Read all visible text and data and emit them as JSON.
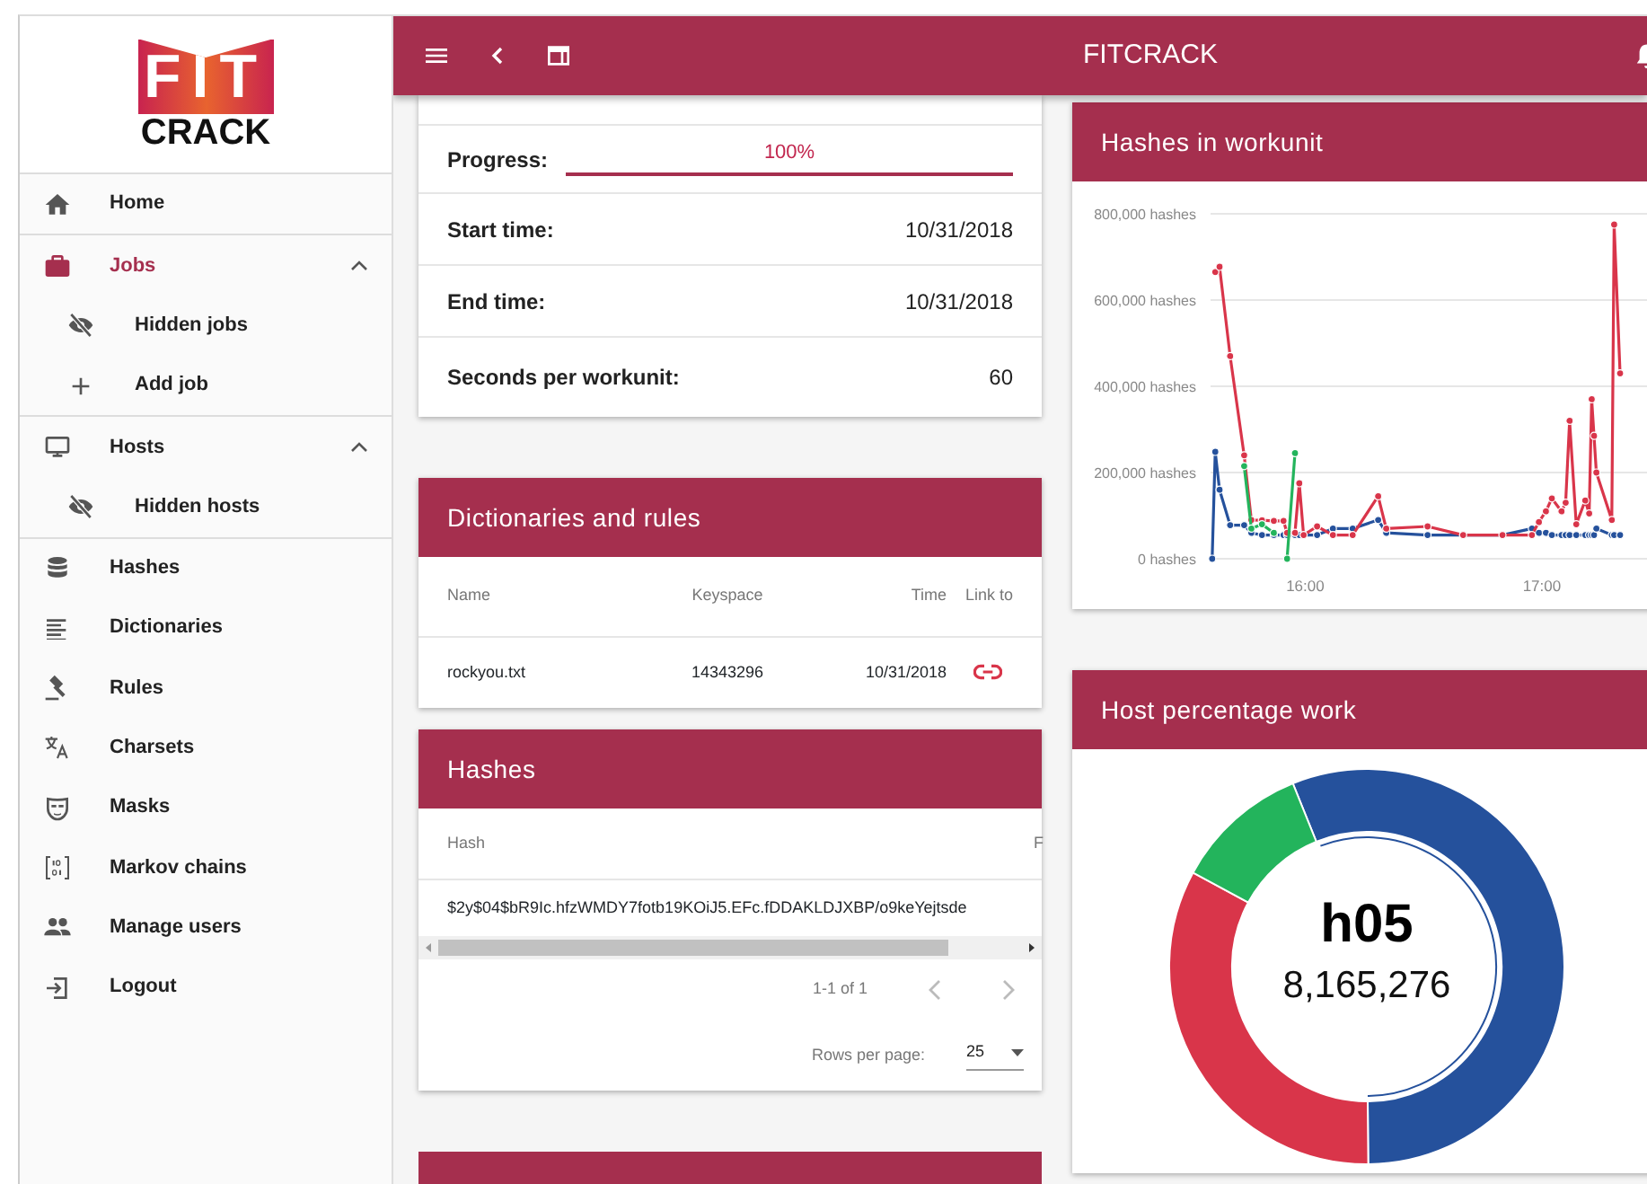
{
  "logo": {
    "top": "FIT",
    "bottom": "CRACK"
  },
  "sidebar": {
    "items": [
      {
        "label": "Home",
        "selected": false
      },
      {
        "label": "Jobs",
        "selected": true,
        "expanded": true,
        "children": [
          {
            "label": "Hidden jobs",
            "selected": false
          },
          {
            "label": "Add job",
            "selected": false
          }
        ]
      },
      {
        "label": "Hosts",
        "selected": false,
        "expanded": true,
        "children": [
          {
            "label": "Hidden hosts",
            "selected": false
          }
        ]
      },
      {
        "label": "Hashes",
        "selected": false
      },
      {
        "label": "Dictionaries",
        "selected": false
      },
      {
        "label": "Rules",
        "selected": false
      },
      {
        "label": "Charsets",
        "selected": false
      },
      {
        "label": "Masks",
        "selected": false
      },
      {
        "label": "Markov chains",
        "selected": false
      },
      {
        "label": "Manage users",
        "selected": false
      },
      {
        "label": "Logout",
        "selected": false
      }
    ]
  },
  "topbar": {
    "title": "FITCRACK"
  },
  "job_info": {
    "progress": {
      "label": "Progress:",
      "reading": "100%",
      "level": 1
    },
    "rows": [
      {
        "label": "Start time:",
        "value": "10/31/2018"
      },
      {
        "label": "End time:",
        "value": "10/31/2018"
      },
      {
        "label": "Seconds per workunit:",
        "value": "60"
      }
    ]
  },
  "dictionaries": {
    "title": "Dictionaries and rules",
    "columns": [
      "Name",
      "Keyspace",
      "Time",
      "Link to"
    ],
    "rows": [
      {
        "name": "rockyou.txt",
        "keyspace": "14343296",
        "time": "10/31/2018"
      }
    ]
  },
  "hashes": {
    "title": "Hashes",
    "columns": [
      "Hash",
      "F"
    ],
    "rows": [
      {
        "hash": "$2y$04$bR9Ic.hfzWMDY7fotb19KOiJ5.EFc.fDDAKLDJXBP/o9keYejtsde"
      }
    ],
    "range": "1-1 of 1",
    "rows_per_page_label": "Rows per page:",
    "rows_per_page": "25"
  },
  "next_card": {
    "kind": "header"
  },
  "workunit_chart": {
    "title": "Hashes in workunit",
    "chart_data": {
      "type": "line",
      "x": [
        15.607,
        15.62,
        15.638,
        15.683,
        15.742,
        15.772,
        15.817,
        15.867,
        15.908,
        15.923,
        15.957,
        15.975,
        15.993,
        16.05,
        16.117,
        16.2,
        16.308,
        16.342,
        16.517,
        16.667,
        16.833,
        16.958,
        16.987,
        17.017,
        17.042,
        17.083,
        17.1,
        17.117,
        17.145,
        17.183,
        17.2,
        17.21,
        17.22,
        17.23,
        17.295,
        17.305,
        17.33
      ],
      "series": [
        {
          "color": "#25519c",
          "values": [
            0,
            248000,
            160000,
            78000,
            78000,
            60000,
            55000,
            55000,
            55000,
            55000,
            55000,
            55000,
            55000,
            55000,
            70000,
            70000,
            90000,
            60000,
            55000,
            55000,
            55000,
            70000,
            60000,
            60000,
            55000,
            55000,
            55000,
            55000,
            55000,
            55000,
            55000,
            55000,
            55000,
            70000,
            55000,
            55000,
            55000
          ]
        },
        {
          "color": "#d9354a",
          "values": [
            null,
            665000,
            677000,
            470000,
            240000,
            90000,
            89000,
            88000,
            88000,
            60000,
            60000,
            175000,
            55000,
            75000,
            55000,
            55000,
            145000,
            70000,
            75000,
            55000,
            55000,
            55000,
            85000,
            110000,
            140000,
            110000,
            130000,
            320000,
            80000,
            135000,
            105000,
            370000,
            285000,
            200000,
            90000,
            775000,
            430000
          ]
        },
        {
          "color": "#23b45c",
          "values": [
            null,
            null,
            null,
            null,
            215000,
            70000,
            80000,
            60000,
            null,
            0,
            245000,
            null,
            null,
            null,
            null,
            null,
            null,
            null,
            null,
            null,
            null,
            null,
            null,
            null,
            null,
            null,
            null,
            null,
            null,
            null,
            null,
            null,
            null,
            null,
            null,
            null,
            null
          ]
        }
      ],
      "xlim": [
        15.6,
        17.52
      ],
      "ylim": [
        0,
        800000
      ],
      "grid": true,
      "xticks": [
        {
          "value": 16,
          "label": "16:00"
        },
        {
          "value": 17,
          "label": "17:00"
        }
      ],
      "yticks": [
        {
          "value": 0,
          "label": "0 hashes"
        },
        {
          "value": 200000,
          "label": "200,000 hashes"
        },
        {
          "value": 400000,
          "label": "400,000 hashes"
        },
        {
          "value": 600000,
          "label": "600,000 hashes"
        },
        {
          "value": 800000,
          "label": "800,000 hashes"
        }
      ]
    }
  },
  "host_work": {
    "title": "Host percentage work",
    "center_label": "h05",
    "center_value": "8,165,276",
    "slices": [
      {
        "color": "#25519c",
        "selected": true
      },
      {
        "color": "#d9354a",
        "selected": false
      },
      {
        "color": "#23b45c",
        "selected": false
      }
    ]
  }
}
